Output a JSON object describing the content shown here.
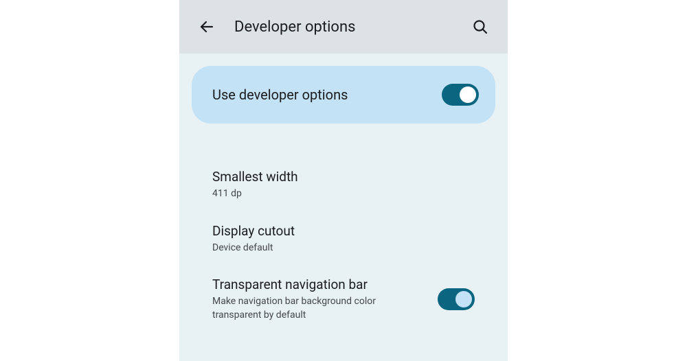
{
  "header": {
    "title": "Developer options"
  },
  "master_toggle": {
    "label": "Use developer options",
    "enabled": true
  },
  "settings": [
    {
      "title": "Smallest width",
      "subtitle": "411 dp",
      "has_toggle": false
    },
    {
      "title": "Display cutout",
      "subtitle": "Device default",
      "has_toggle": false
    },
    {
      "title": "Transparent navigation bar",
      "subtitle": "Make navigation bar background color transparent by default",
      "has_toggle": true,
      "toggle_on": true
    }
  ]
}
